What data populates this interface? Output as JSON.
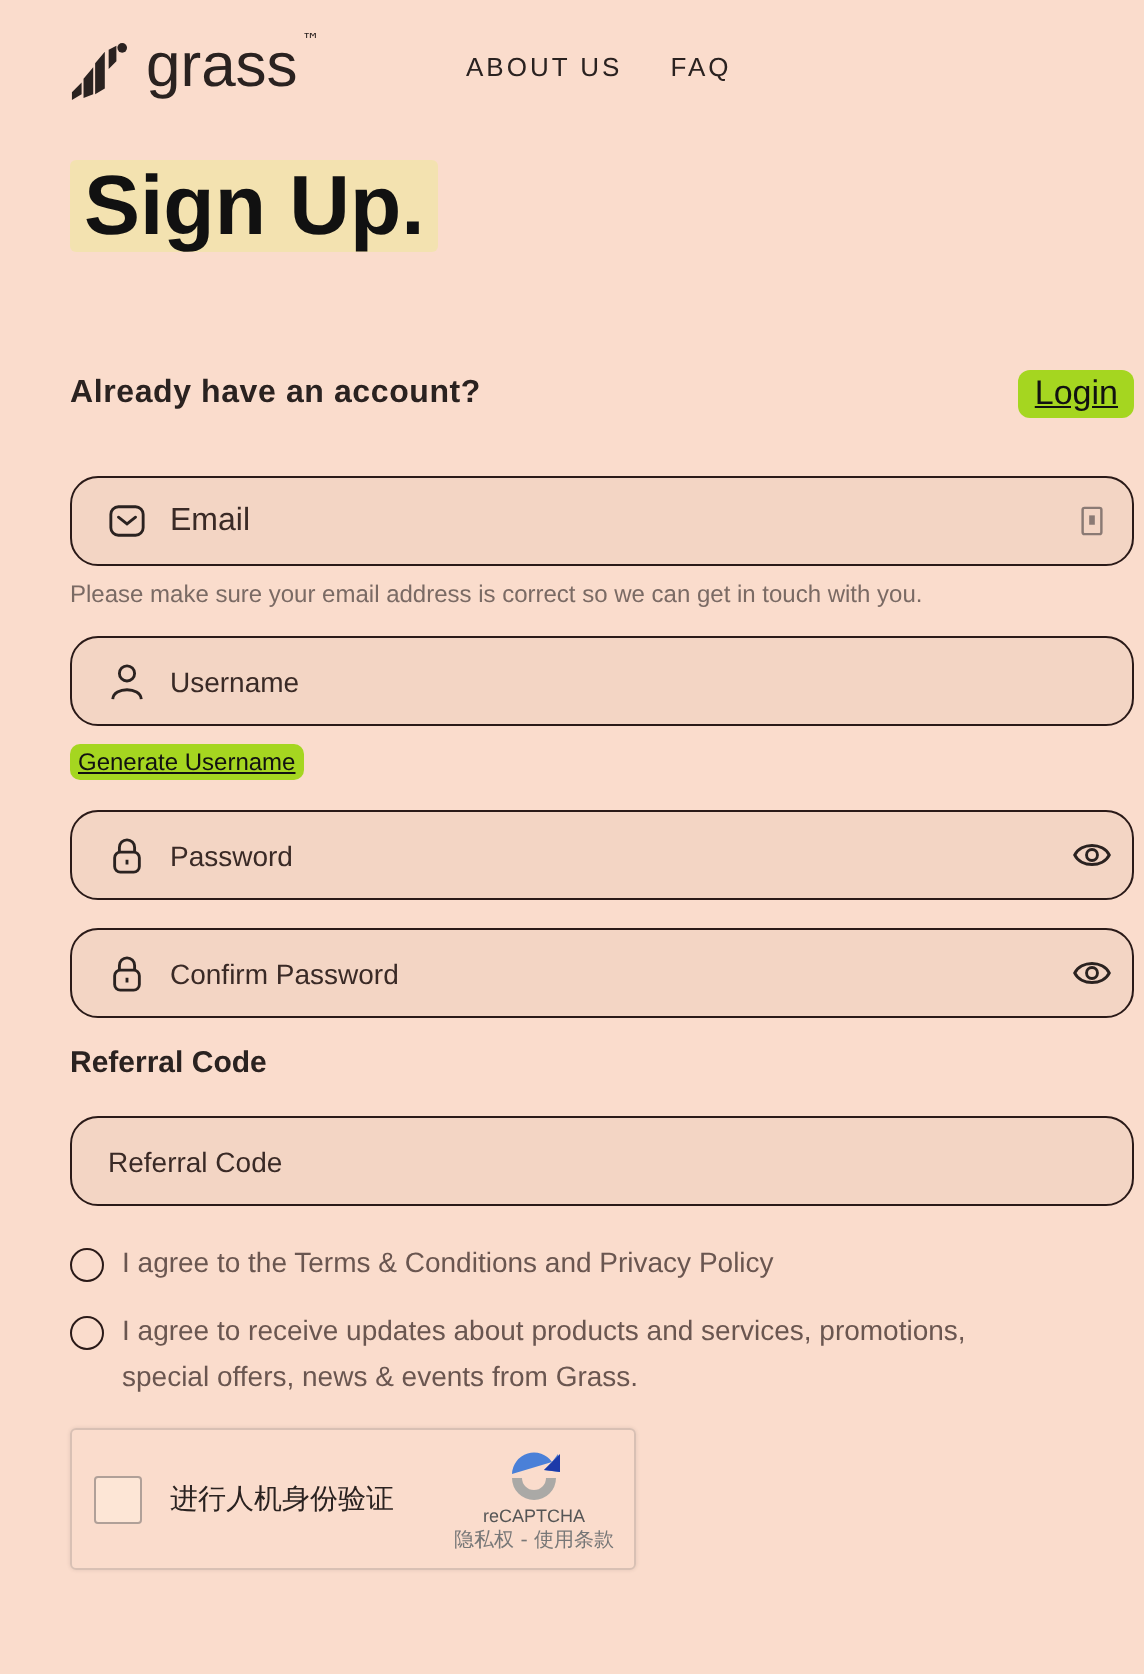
{
  "header": {
    "logo": "grass",
    "trademark": "™",
    "nav": [
      "ABOUT US",
      "FAQ"
    ]
  },
  "title": "Sign Up.",
  "account": {
    "prompt": "Already have an account?",
    "login": "Login"
  },
  "fields": [
    {
      "kind": "email",
      "placeholder": "Email",
      "hint": "Please make sure your email address is correct so we can get in touch with you."
    },
    {
      "kind": "user",
      "placeholder": "Username",
      "action": "Generate Username"
    },
    {
      "kind": "password",
      "placeholder": "Password"
    },
    {
      "kind": "password",
      "placeholder": "Confirm Password"
    }
  ],
  "referral": {
    "label": "Referral Code",
    "placeholder": "Referral Code"
  },
  "agreements": [
    {
      "text": "I agree to the Terms & Conditions and Privacy Policy",
      "checked": false
    },
    {
      "text": "I agree to receive updates about products and services, promotions, special offers, news & events from Grass.",
      "checked": false
    }
  ],
  "captcha": {
    "label": "进行人机身份验证",
    "checked": false,
    "brand": "reCAPTCHA",
    "links": "隐私权 - 使用条款"
  }
}
